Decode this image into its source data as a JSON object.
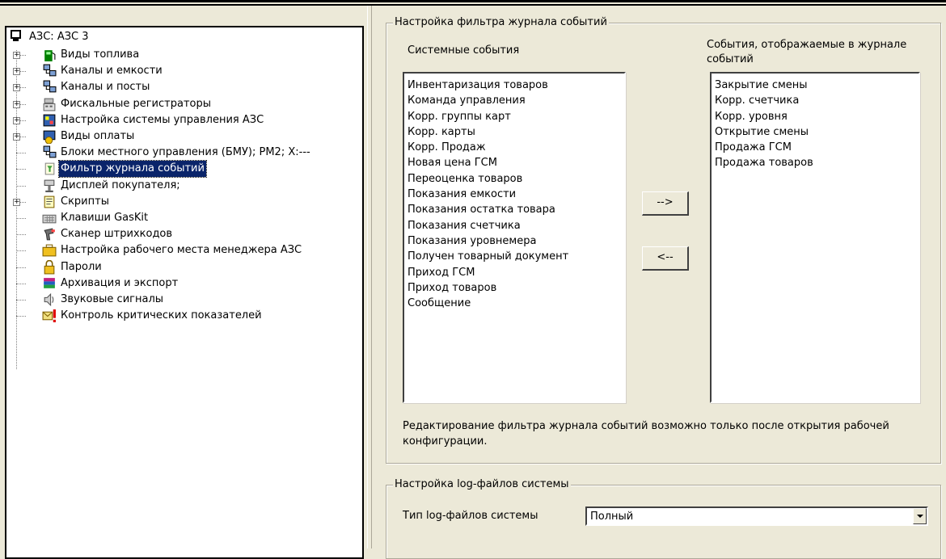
{
  "tree": {
    "root": "АЗС: АЗС 3",
    "items": [
      {
        "label": "Виды топлива",
        "icon": "fuel-pump-icon",
        "expander": true
      },
      {
        "label": "Каналы и емкости",
        "icon": "network-device-icon",
        "expander": true
      },
      {
        "label": "Каналы и посты",
        "icon": "network-device-icon",
        "expander": true
      },
      {
        "label": "Фискальные регистраторы",
        "icon": "cash-register-icon",
        "expander": true
      },
      {
        "label": "Настройка системы управления АЗС",
        "icon": "control-panel-icon",
        "expander": true
      },
      {
        "label": "Виды оплаты",
        "icon": "payment-icon",
        "expander": true
      },
      {
        "label": "Блоки местного управления (БМУ);  РМ2;  X:---",
        "icon": "network-device-icon",
        "expander": false
      },
      {
        "label": "Фильтр журнала событий",
        "icon": "filter-icon",
        "expander": false,
        "selected": true
      },
      {
        "label": "Дисплей покупателя;",
        "icon": "display-icon",
        "expander": false
      },
      {
        "label": "Скрипты",
        "icon": "script-icon",
        "expander": true
      },
      {
        "label": "Клавиши GasKit",
        "icon": "keyboard-icon",
        "expander": false
      },
      {
        "label": "Сканер штрихкодов",
        "icon": "barcode-scanner-icon",
        "expander": false
      },
      {
        "label": "Настройка рабочего места менеджера АЗС",
        "icon": "briefcase-icon",
        "expander": false
      },
      {
        "label": "Пароли",
        "icon": "lock-icon",
        "expander": false
      },
      {
        "label": "Архивация и экспорт",
        "icon": "archive-icon",
        "expander": false
      },
      {
        "label": "Звуковые сигналы",
        "icon": "speaker-icon",
        "expander": false
      },
      {
        "label": "Контроль критических показателей",
        "icon": "warning-mail-icon",
        "expander": false
      }
    ]
  },
  "filter": {
    "group_title": "Настройка фильтра журнала событий",
    "system_events_label": "Системные события",
    "journal_events_label": "События, отображаемые в журнале событий",
    "system_events": [
      "Инвентаризация товаров",
      "Команда управления",
      "Корр. группы карт",
      "Корр. карты",
      "Корр. Продаж",
      "Новая цена ГСМ",
      "Переоценка товаров",
      "Показания емкости",
      "Показания остатка товара",
      "Показания счетчика",
      "Показания уровнемера",
      "Получен товарный документ",
      "Приход ГСМ",
      "Приход товаров",
      "Сообщение"
    ],
    "journal_events": [
      "Закрытие смены",
      "Корр. счетчика",
      "Корр. уровня",
      "Открытие смены",
      "Продажа ГСМ",
      "Продажа товаров"
    ],
    "add_button": "-->",
    "remove_button": "<--",
    "note": "Редактирование фильтра журнала событий возможно только после открытия рабочей конфигурации."
  },
  "logs": {
    "group_title": "Настройка log-файлов системы",
    "type_label": "Тип log-файлов системы",
    "type_value": "Полный"
  }
}
